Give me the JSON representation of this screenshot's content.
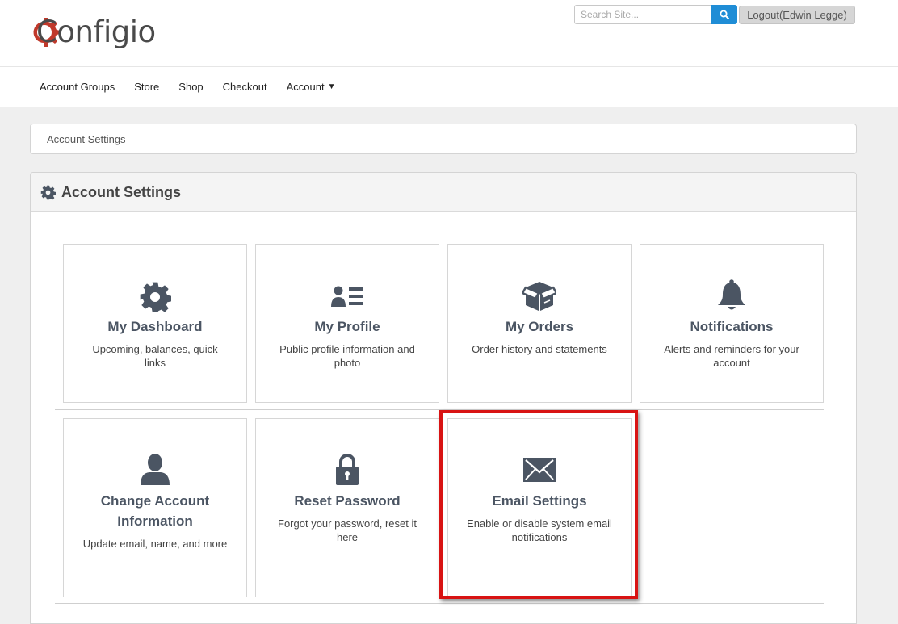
{
  "header": {
    "logo_text": "Configio",
    "search": {
      "placeholder": "Search Site..."
    },
    "logout_label": "Logout(Edwin Legge)"
  },
  "nav": {
    "items": [
      {
        "label": "Account Groups"
      },
      {
        "label": "Store"
      },
      {
        "label": "Shop"
      },
      {
        "label": "Checkout"
      },
      {
        "label": "Account"
      }
    ]
  },
  "breadcrumb": {
    "current": "Account Settings"
  },
  "panel": {
    "title": "Account Settings",
    "cards": [
      {
        "title": "My Dashboard",
        "description": "Upcoming, balances, quick links",
        "icon": "gear-icon"
      },
      {
        "title": "My Profile",
        "description": "Public profile information and photo",
        "icon": "profile-card-icon"
      },
      {
        "title": "My Orders",
        "description": "Order history and statements",
        "icon": "open-box-icon"
      },
      {
        "title": "Notifications",
        "description": "Alerts and reminders for your account",
        "icon": "bell-icon"
      },
      {
        "title": "Change Account Information",
        "description": "Update email, name, and more",
        "icon": "user-icon"
      },
      {
        "title": "Reset Password",
        "description": "Forgot your password, reset it here",
        "icon": "lock-icon"
      },
      {
        "title": "Email Settings",
        "description": "Enable or disable system email notifications",
        "icon": "envelope-icon"
      }
    ]
  },
  "colors": {
    "accent": "#1f8dd6",
    "logo_red": "#c0392b",
    "icon_slate": "#4b5563",
    "highlight": "#d81313"
  }
}
